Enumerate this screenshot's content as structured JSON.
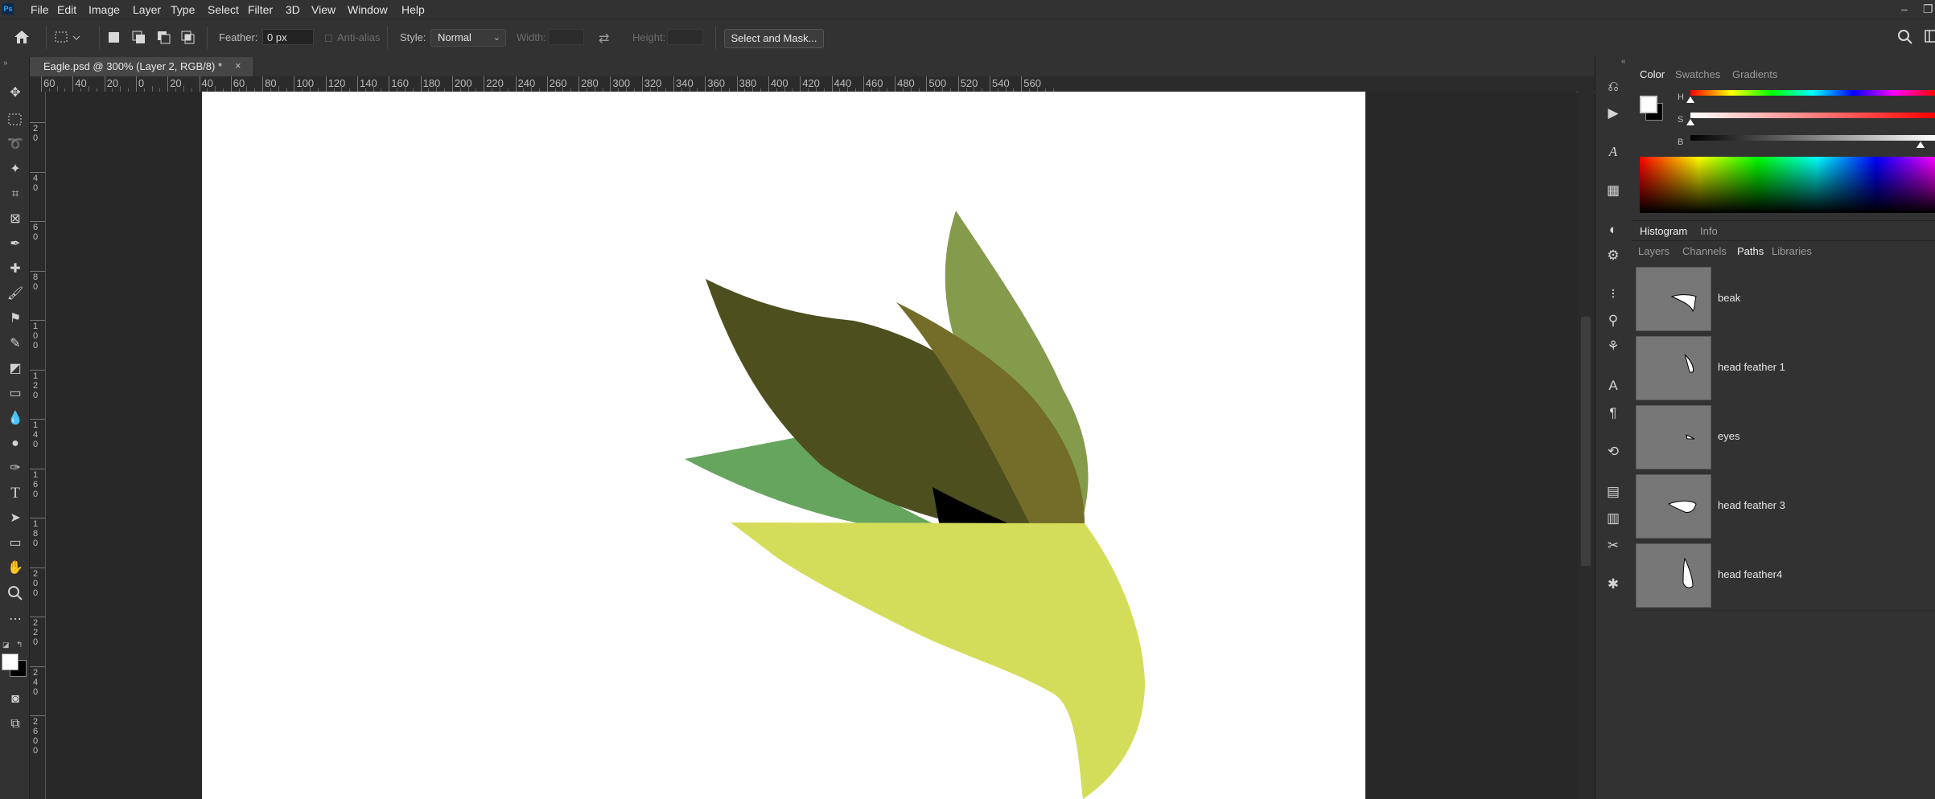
{
  "app": {
    "logo_text": "Ps"
  },
  "menu": [
    "File",
    "Edit",
    "Image",
    "Layer",
    "Type",
    "Select",
    "Filter",
    "3D",
    "View",
    "Window",
    "Help"
  ],
  "options": {
    "feather_label": "Feather:",
    "feather_value": "0 px",
    "antialias_label": "Anti-alias",
    "style_label": "Style:",
    "style_value": "Normal",
    "width_label": "Width:",
    "height_label": "Height:",
    "select_mask_button": "Select and Mask..."
  },
  "document": {
    "tab_title": "Eagle.psd @ 300% (Layer 2, RGB/8) *",
    "close_glyph": "×"
  },
  "ruler_h": [
    "60",
    "40",
    "20",
    "0",
    "20",
    "40",
    "60",
    "80",
    "100",
    "120",
    "140",
    "160",
    "180",
    "200",
    "220",
    "240",
    "260",
    "280",
    "300",
    "320",
    "340",
    "360",
    "380",
    "400",
    "420",
    "440",
    "460",
    "480",
    "500",
    "520",
    "540",
    "560"
  ],
  "ruler_v": [
    [
      "2",
      "0"
    ],
    [
      "4",
      "0"
    ],
    [
      "6",
      "0"
    ],
    [
      "8",
      "0"
    ],
    [
      "1",
      "0",
      "0"
    ],
    [
      "1",
      "2",
      "0"
    ],
    [
      "1",
      "4",
      "0"
    ],
    [
      "1",
      "6",
      "0"
    ],
    [
      "1",
      "8",
      "0"
    ],
    [
      "2",
      "0",
      "0"
    ],
    [
      "2",
      "2",
      "0"
    ],
    [
      "2",
      "4",
      "0"
    ],
    [
      "2",
      "6",
      "0",
      "0"
    ]
  ],
  "colors": {
    "feather_dark": "#4d4f1f",
    "feather_light": "#849b4c",
    "feather_mid": "#746d29",
    "feather_green": "#66a55e",
    "beak_yellow": "#d4dd5a",
    "accent": "#31a8ff"
  },
  "panels": {
    "color_tabs": [
      "Color",
      "Swatches",
      "Gradients"
    ],
    "hsb_labels": [
      "H",
      "S",
      "B"
    ],
    "hist_tabs": [
      "Histogram",
      "Info"
    ],
    "layer_tabs": [
      "Layers",
      "Channels",
      "Paths",
      "Libraries"
    ],
    "paths": [
      {
        "name": "beak"
      },
      {
        "name": "head feather 1"
      },
      {
        "name": "eyes"
      },
      {
        "name": "head feather 3"
      },
      {
        "name": "head feather4"
      }
    ]
  },
  "icons": {
    "home": "home-icon",
    "search": "search-icon",
    "workspace": "workspace-icon"
  }
}
